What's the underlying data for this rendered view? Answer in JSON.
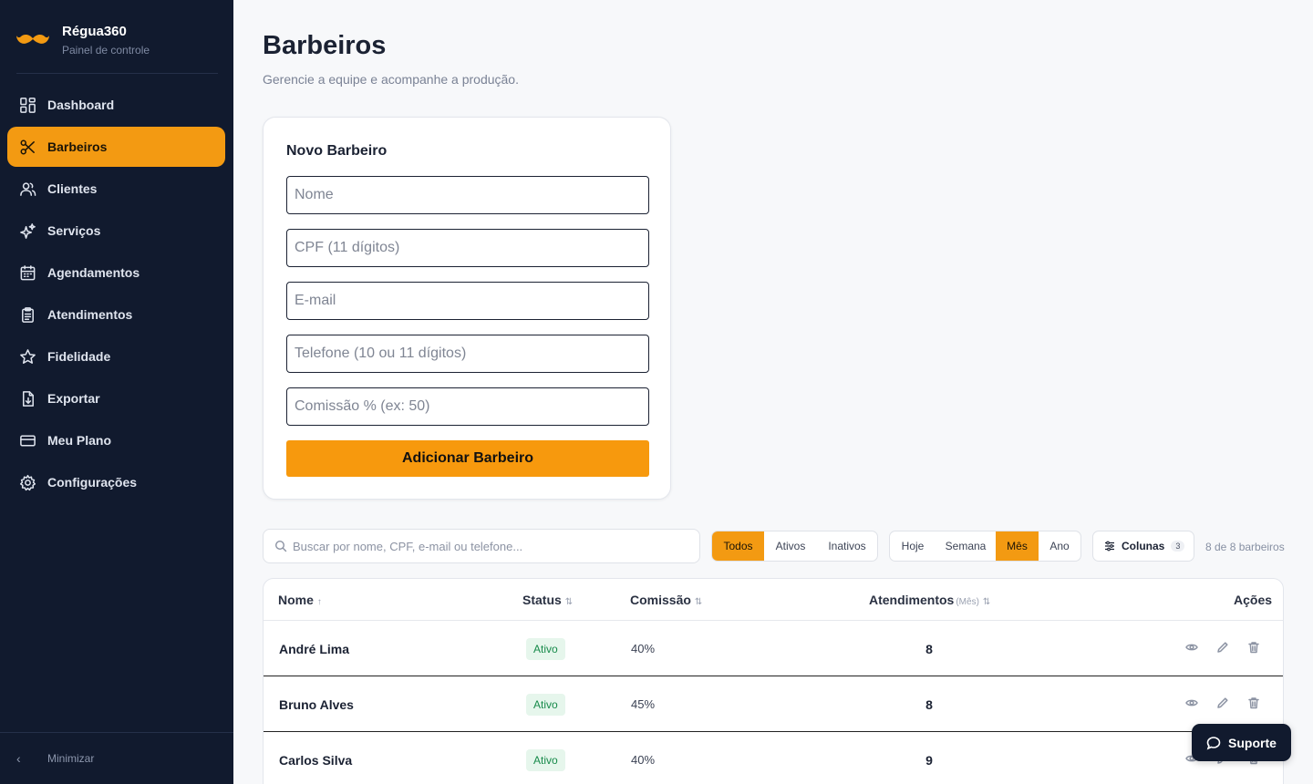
{
  "brand": {
    "name": "Régua360",
    "subtitle": "Painel de controle",
    "logo_icon": "mustache-icon",
    "accent": "#f39a12"
  },
  "sidebar": {
    "items": [
      {
        "label": "Dashboard",
        "icon": "dashboard-icon",
        "active": false
      },
      {
        "label": "Barbeiros",
        "icon": "scissors-icon",
        "active": true
      },
      {
        "label": "Clientes",
        "icon": "users-icon",
        "active": false
      },
      {
        "label": "Serviços",
        "icon": "sparkles-icon",
        "active": false
      },
      {
        "label": "Agendamentos",
        "icon": "calendar-icon",
        "active": false
      },
      {
        "label": "Atendimentos",
        "icon": "clipboard-icon",
        "active": false
      },
      {
        "label": "Fidelidade",
        "icon": "star-icon",
        "active": false
      },
      {
        "label": "Exportar",
        "icon": "export-file-icon",
        "active": false
      },
      {
        "label": "Meu Plano",
        "icon": "credit-card-icon",
        "active": false
      },
      {
        "label": "Configurações",
        "icon": "gear-icon",
        "active": false
      }
    ],
    "minimize_label": "Minimizar"
  },
  "page": {
    "title": "Barbeiros",
    "subtitle": "Gerencie a equipe e acompanhe a produção."
  },
  "form": {
    "title": "Novo Barbeiro",
    "fields": {
      "nome": {
        "placeholder": "Nome",
        "value": ""
      },
      "cpf": {
        "placeholder": "CPF (11 dígitos)",
        "value": ""
      },
      "email": {
        "placeholder": "E-mail",
        "value": ""
      },
      "telefone": {
        "placeholder": "Telefone (10 ou 11 dígitos)",
        "value": ""
      },
      "comissao": {
        "placeholder": "Comissão % (ex: 50)",
        "value": ""
      }
    },
    "submit_label": "Adicionar Barbeiro"
  },
  "toolbar": {
    "search_placeholder": "Buscar por nome, CPF, e-mail ou telefone...",
    "status_filter": {
      "options": [
        "Todos",
        "Ativos",
        "Inativos"
      ],
      "selected": "Todos"
    },
    "period_filter": {
      "options": [
        "Hoje",
        "Semana",
        "Mês",
        "Ano"
      ],
      "selected": "Mês"
    },
    "columns_label": "Colunas",
    "columns_count": "3",
    "result_count": "8 de 8 barbeiros"
  },
  "table": {
    "headers": {
      "nome": "Nome",
      "nome_sort": "↑",
      "status": "Status",
      "comissao": "Comissão",
      "atendimentos": "Atendimentos",
      "atendimentos_unit": "(Mês)",
      "acoes": "Ações",
      "sort_icon": "⇅"
    },
    "rows": [
      {
        "nome": "André Lima",
        "status": "Ativo",
        "comissao": "40%",
        "atendimentos": "8"
      },
      {
        "nome": "Bruno Alves",
        "status": "Ativo",
        "comissao": "45%",
        "atendimentos": "8"
      },
      {
        "nome": "Carlos Silva",
        "status": "Ativo",
        "comissao": "40%",
        "atendimentos": "9"
      }
    ]
  },
  "support": {
    "label": "Suporte",
    "icon": "chat-bubble-icon"
  }
}
